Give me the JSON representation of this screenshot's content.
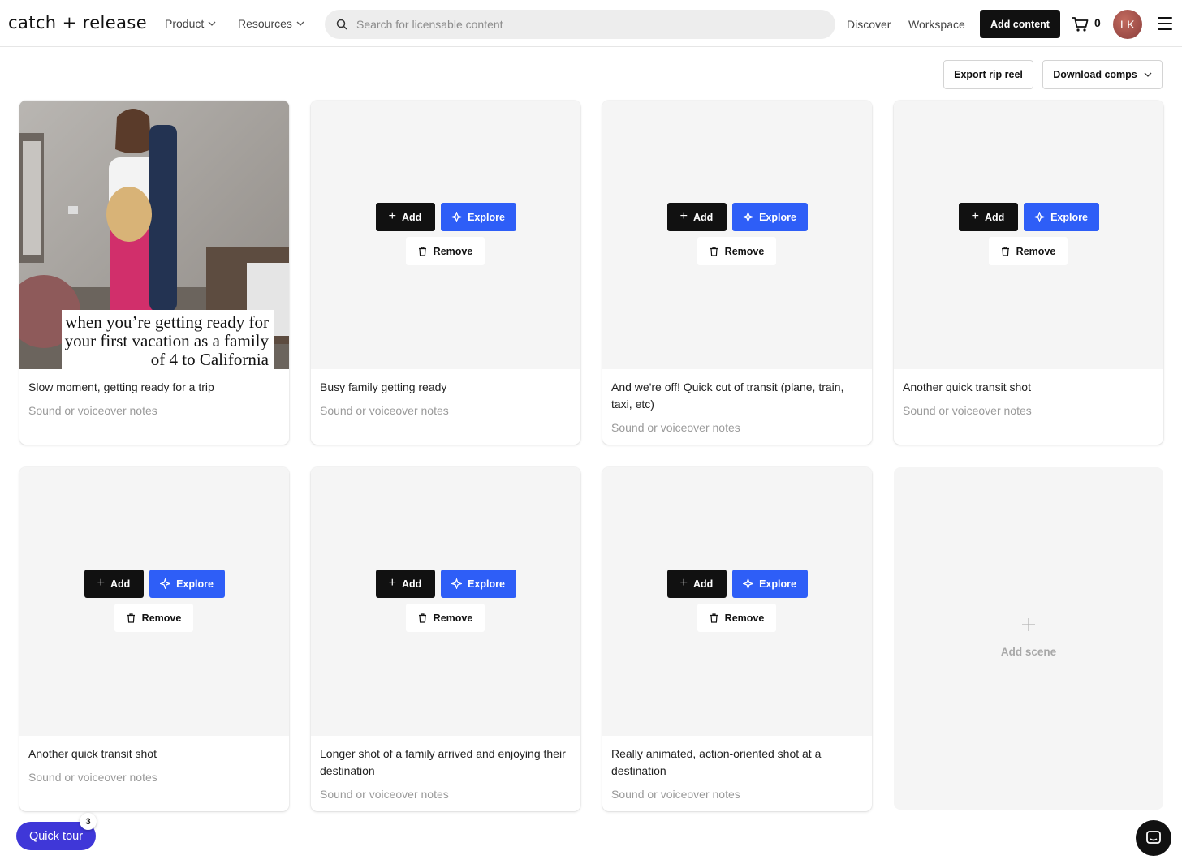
{
  "header": {
    "logo": "catch + release",
    "product_menu": "Product",
    "resources_menu": "Resources",
    "search_placeholder": "Search for licensable content",
    "discover": "Discover",
    "workspace": "Workspace",
    "add_content": "Add content",
    "cart_count": "0",
    "avatar_initials": "LK"
  },
  "toolbar": {
    "export_label": "Export rip reel",
    "download_label": "Download comps"
  },
  "card_actions": {
    "add": "Add",
    "explore": "Explore",
    "remove": "Remove"
  },
  "scenes": [
    {
      "description": "Slow moment, getting ready for a trip",
      "notes": "Sound or voiceover notes",
      "thumbnail_caption": "when you’re getting ready for your first vacation as a family of 4 to California"
    },
    {
      "description": "Busy family getting ready",
      "notes": "Sound or voiceover notes"
    },
    {
      "description": "And we're off! Quick cut of transit (plane, train, taxi, etc)",
      "notes": "Sound or voiceover notes"
    },
    {
      "description": "Another quick transit shot",
      "notes": "Sound or voiceover notes"
    },
    {
      "description": "Another quick transit shot",
      "notes": "Sound or voiceover notes"
    },
    {
      "description": "Longer shot of a family arrived and enjoying their destination",
      "notes": "Sound or voiceover notes"
    },
    {
      "description": "Really animated, action-oriented shot at a destination",
      "notes": "Sound or voiceover notes"
    }
  ],
  "add_scene_label": "Add scene",
  "quick_tour": {
    "label": "Quick tour",
    "badge": "3"
  },
  "colors": {
    "primary_dark": "#111111",
    "explore_blue": "#2e5ef7",
    "quick_tour_purple": "#3f37d8",
    "placeholder_bg": "#f5f5f5"
  },
  "icons": [
    "search-icon",
    "chevron-down-icon",
    "cart-icon",
    "hamburger-icon",
    "plus-icon",
    "sparkle-icon",
    "trash-icon",
    "chat-icon"
  ]
}
